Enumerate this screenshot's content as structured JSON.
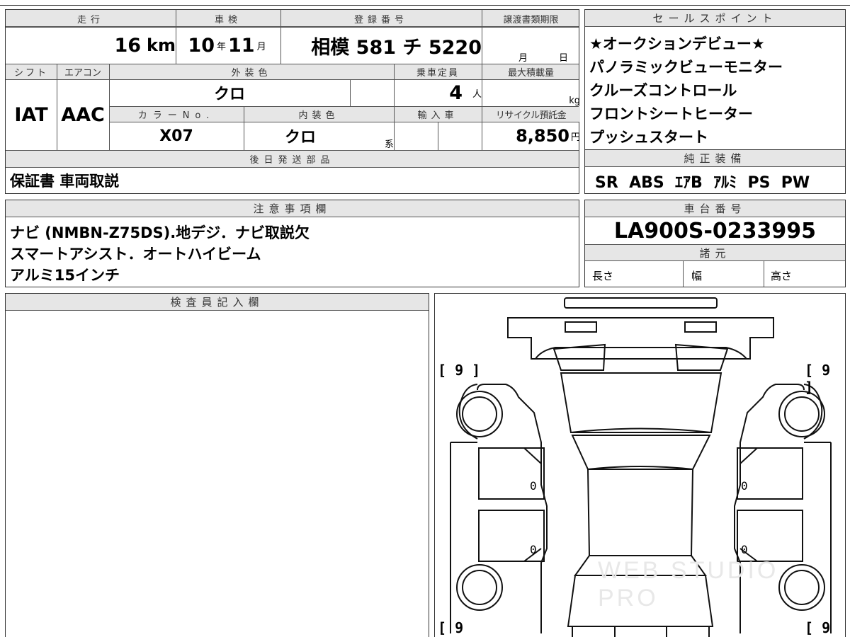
{
  "vehicle": {
    "headers": {
      "mileage": "走行",
      "inspection": "車検",
      "registration": "登録番号",
      "transfer_deadline": "譲渡書類期限",
      "shift": "シフト",
      "aircon": "エアコン",
      "exterior_color": "外装色",
      "capacity": "乗車定員",
      "max_load": "最大積載量",
      "color_no": "カラーNo.",
      "interior_color": "内装色",
      "import": "輸入車",
      "recycle": "リサイクル預託金",
      "later_parts": "後日発送部品"
    },
    "mileage_value": "16",
    "mileage_unit": "km",
    "inspection_year": "10",
    "inspection_year_unit": "年",
    "inspection_month": "11",
    "inspection_month_unit": "月",
    "plate": "相模 581 チ 5220",
    "deadline_month_unit": "月",
    "deadline_day_unit": "日",
    "shift_value": "IAT",
    "aircon_value": "AAC",
    "exterior_color_value": "クロ",
    "capacity_value": "4",
    "capacity_unit": "人",
    "max_load_unit": "kg",
    "color_no_value": "X07",
    "interior_color_value": "クロ",
    "interior_color_suffix": "系",
    "recycle_value": "8,850",
    "recycle_unit": "円",
    "later_parts_value": "保証書 車両取説"
  },
  "sales_points": {
    "header": "セールスポイント",
    "lines": [
      "★オークションデビュー★",
      "パノラミックビューモニター",
      "クルーズコントロール",
      "フロントシートヒーター",
      "プッシュスタート"
    ]
  },
  "equipment": {
    "header": "純正装備",
    "items": "SR  ABS  ｴｱB  ｱﾙﾐ  PS  PW"
  },
  "notes": {
    "header": "注意事項欄",
    "lines": [
      "ナビ (NMBN-Z75DS).地デジ．ナビ取説欠",
      "スマートアシスト．オートハイビーム",
      "アルミ15インチ"
    ]
  },
  "chassis": {
    "header": "車台番号",
    "value": "LA900S-0233995",
    "spec_header": "諸元",
    "length": "長さ",
    "width": "幅",
    "height": "高さ"
  },
  "inspector": {
    "header": "検査員記入欄"
  },
  "diagram": {
    "tire_front_left": "[ 9 ]",
    "tire_front_right": "[ 9 ]",
    "tire_rear_left": "[ 9",
    "tire_rear_right": "[ 9 ]",
    "door_count_fl": "0",
    "door_count_fr": "0",
    "door_count_rl": "0",
    "door_count_rr": "0",
    "watermark": "WEB STUDIO PRO"
  }
}
